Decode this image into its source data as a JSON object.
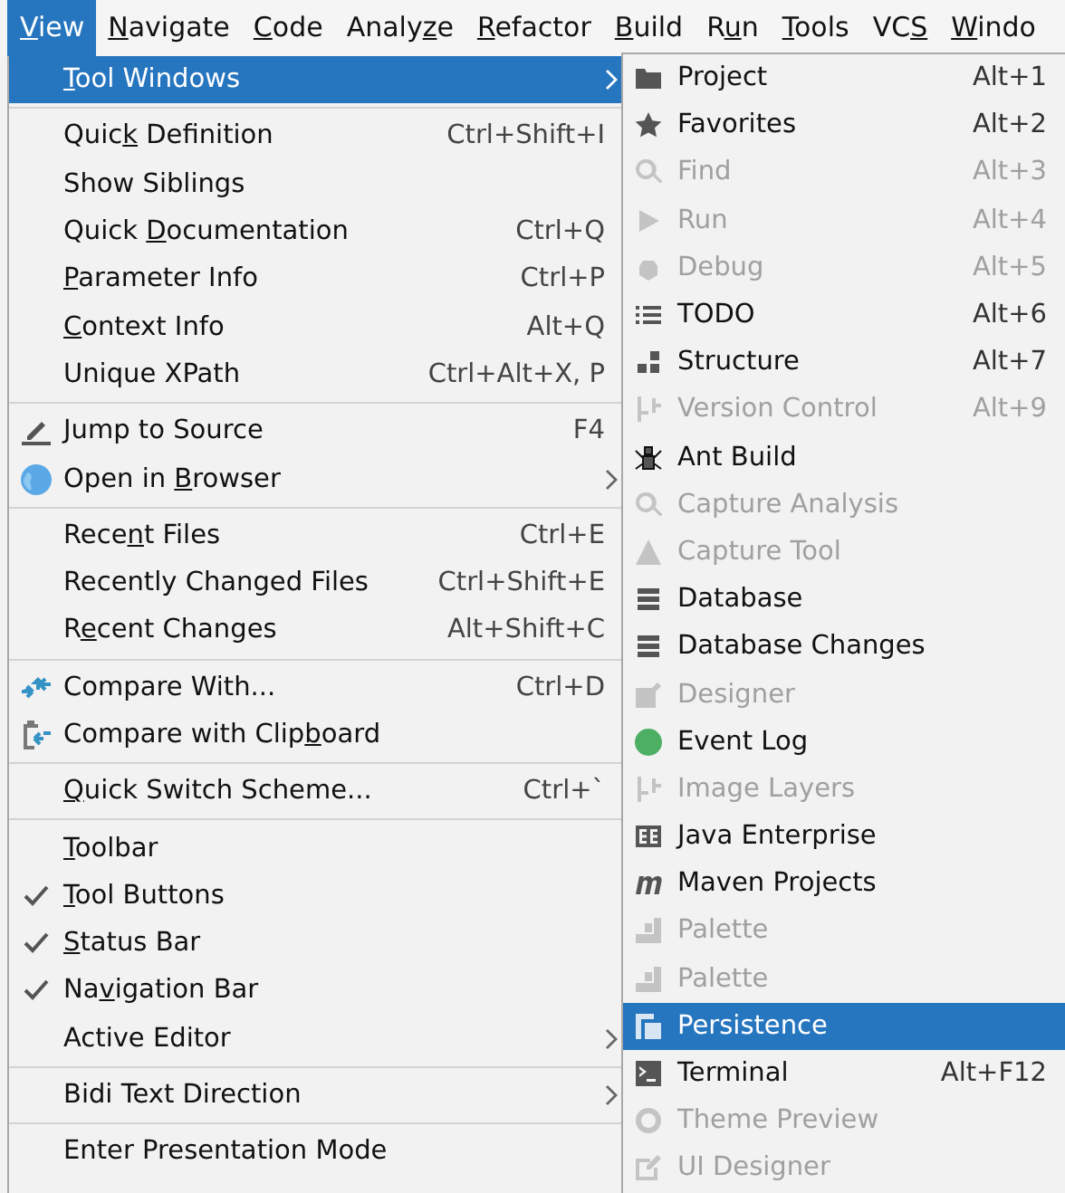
{
  "menubar": [
    {
      "key": "V",
      "post": "iew",
      "selected": true
    },
    {
      "key": "N",
      "post": "avigate",
      "selected": false
    },
    {
      "key": "C",
      "post": "ode",
      "selected": false
    },
    {
      "pre": "Analy",
      "key": "z",
      "post": "e",
      "selected": false
    },
    {
      "key": "R",
      "post": "efactor",
      "selected": false
    },
    {
      "key": "B",
      "post": "uild",
      "selected": false
    },
    {
      "pre": "R",
      "key": "u",
      "post": "n",
      "selected": false
    },
    {
      "key": "T",
      "post": "ools",
      "selected": false
    },
    {
      "pre": "VC",
      "key": "S",
      "selected": false
    },
    {
      "key": "W",
      "post": "indo",
      "selected": false
    }
  ],
  "view_menu": [
    {
      "kind": "item",
      "key": "T",
      "post": "ool Windows",
      "submenu": true,
      "selected": true,
      "checked": false
    },
    {
      "kind": "separator"
    },
    {
      "kind": "item",
      "pre": "Quic",
      "key": "k",
      "post": " Definition",
      "shortcut": "Ctrl+Shift+I",
      "selected": false,
      "checked": false
    },
    {
      "kind": "item",
      "label": "Show Siblings",
      "selected": false,
      "checked": false
    },
    {
      "kind": "item",
      "pre": "Quick ",
      "key": "D",
      "post": "ocumentation",
      "shortcut": "Ctrl+Q",
      "selected": false,
      "checked": false
    },
    {
      "kind": "item",
      "key": "P",
      "post": "arameter Info",
      "shortcut": "Ctrl+P",
      "selected": false,
      "checked": false
    },
    {
      "kind": "item",
      "key": "C",
      "post": "ontext Info",
      "shortcut": "Alt+Q",
      "selected": false,
      "checked": false
    },
    {
      "kind": "item",
      "label": "Unique XPath",
      "shortcut": "Ctrl+Alt+X, P",
      "selected": false,
      "checked": false
    },
    {
      "kind": "separator"
    },
    {
      "kind": "item",
      "label": "Jump to Source",
      "shortcut": "F4",
      "selected": false,
      "checked": false
    },
    {
      "kind": "item",
      "pre": "Open in ",
      "key": "B",
      "post": "rowser",
      "submenu": true,
      "selected": false,
      "checked": false
    },
    {
      "kind": "separator"
    },
    {
      "kind": "item",
      "pre": "Rece",
      "key": "n",
      "post": "t Files",
      "shortcut": "Ctrl+E",
      "selected": false,
      "checked": false
    },
    {
      "kind": "item",
      "label": "Recently Changed Files",
      "shortcut": "Ctrl+Shift+E",
      "selected": false,
      "checked": false
    },
    {
      "kind": "item",
      "pre": "R",
      "key": "e",
      "post": "cent Changes",
      "shortcut": "Alt+Shift+C",
      "selected": false,
      "checked": false
    },
    {
      "kind": "separator"
    },
    {
      "kind": "item",
      "label": "Compare With...",
      "shortcut": "Ctrl+D",
      "selected": false,
      "checked": false
    },
    {
      "kind": "item",
      "pre": "Compare with Clip",
      "key": "b",
      "post": "oard",
      "selected": false,
      "checked": false
    },
    {
      "kind": "separator"
    },
    {
      "kind": "item",
      "key": "Q",
      "post": "uick Switch Scheme...",
      "shortcut": "Ctrl+`",
      "selected": false,
      "checked": false
    },
    {
      "kind": "separator"
    },
    {
      "kind": "item",
      "key": "T",
      "post": "oolbar",
      "selected": false,
      "checked": false
    },
    {
      "kind": "item",
      "key": "T",
      "post": "ool Buttons",
      "selected": false,
      "checked": true
    },
    {
      "kind": "item",
      "key": "S",
      "post": "tatus Bar",
      "selected": false,
      "checked": true
    },
    {
      "kind": "item",
      "pre": "Na",
      "key": "v",
      "post": "igation Bar",
      "selected": false,
      "checked": true
    },
    {
      "kind": "item",
      "label": "Active Editor",
      "submenu": true,
      "selected": false,
      "checked": false
    },
    {
      "kind": "separator"
    },
    {
      "kind": "item",
      "label": "Bidi Text Direction",
      "submenu": true,
      "selected": false,
      "checked": false
    },
    {
      "kind": "separator"
    },
    {
      "kind": "item",
      "label": "Enter Presentation Mode",
      "selected": false,
      "checked": false
    }
  ],
  "tool_windows_menu": [
    {
      "label": "Project",
      "shortcut": "Alt+1",
      "disabled": false,
      "selected": false
    },
    {
      "label": "Favorites",
      "shortcut": "Alt+2",
      "disabled": false,
      "selected": false
    },
    {
      "label": "Find",
      "shortcut": "Alt+3",
      "disabled": true,
      "selected": false
    },
    {
      "label": "Run",
      "shortcut": "Alt+4",
      "disabled": true,
      "selected": false
    },
    {
      "label": "Debug",
      "shortcut": "Alt+5",
      "disabled": true,
      "selected": false
    },
    {
      "label": "TODO",
      "shortcut": "Alt+6",
      "disabled": false,
      "selected": false
    },
    {
      "label": "Structure",
      "shortcut": "Alt+7",
      "disabled": false,
      "selected": false
    },
    {
      "label": "Version Control",
      "shortcut": "Alt+9",
      "disabled": true,
      "selected": false
    },
    {
      "label": "Ant Build",
      "disabled": false,
      "selected": false
    },
    {
      "label": "Capture Analysis",
      "disabled": true,
      "selected": false
    },
    {
      "label": "Capture Tool",
      "disabled": true,
      "selected": false
    },
    {
      "label": "Database",
      "disabled": false,
      "selected": false
    },
    {
      "label": "Database Changes",
      "disabled": false,
      "selected": false
    },
    {
      "label": "Designer",
      "disabled": true,
      "selected": false
    },
    {
      "label": "Event Log",
      "disabled": false,
      "selected": false
    },
    {
      "label": "Image Layers",
      "disabled": true,
      "selected": false
    },
    {
      "label": "Java Enterprise",
      "disabled": false,
      "selected": false
    },
    {
      "label": "Maven Projects",
      "disabled": false,
      "selected": false
    },
    {
      "label": "Palette",
      "disabled": true,
      "selected": false
    },
    {
      "label": "Palette",
      "disabled": true,
      "selected": false
    },
    {
      "label": "Persistence",
      "disabled": false,
      "selected": true
    },
    {
      "label": "Terminal",
      "shortcut": "Alt+F12",
      "disabled": false,
      "selected": false
    },
    {
      "label": "Theme Preview",
      "disabled": true,
      "selected": false
    },
    {
      "label": "UI Designer",
      "disabled": true,
      "selected": false
    }
  ]
}
